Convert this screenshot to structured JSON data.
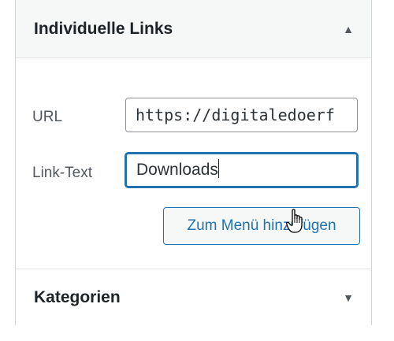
{
  "sections": {
    "links": {
      "title": "Individuelle Links",
      "toggle_icon": "triangle-up"
    },
    "categories": {
      "title": "Kategorien",
      "toggle_icon": "triangle-down"
    }
  },
  "form": {
    "url_label": "URL",
    "url_value": "https://digitaledoerf",
    "link_text_label": "Link-Text",
    "link_text_value": "Downloads",
    "add_button": "Zum Menü hinzufügen"
  },
  "glyphs": {
    "collapse": "▲",
    "expand": "▼"
  },
  "colors": {
    "accent": "#2271b1",
    "text": "#1d2327",
    "muted": "#50575e",
    "border": "#8c8f94"
  }
}
